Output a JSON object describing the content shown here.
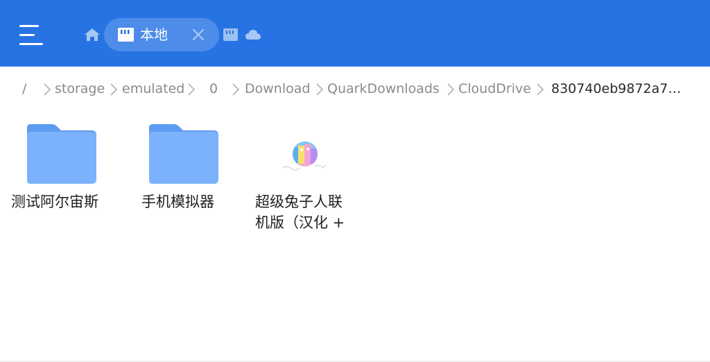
{
  "header": {
    "tabs": [
      {
        "label": "本地",
        "icon": "sd-card-icon",
        "active": true,
        "closable": true
      },
      {
        "label": "",
        "icon": "sd-card-icon",
        "active": false
      },
      {
        "label": "",
        "icon": "cloud-icon",
        "active": false
      }
    ],
    "colors": {
      "bar": "#2773e3",
      "icon": "#ffffff"
    }
  },
  "breadcrumb": {
    "root": "/",
    "items": [
      "storage",
      "emulated",
      "0",
      "Download",
      "QuarkDownloads",
      "CloudDrive"
    ],
    "current": "830740eb9872a7…"
  },
  "files": [
    {
      "name": "测试阿尔宙斯",
      "type": "folder",
      "icon": "folder-icon"
    },
    {
      "name": "手机模拟器",
      "type": "folder",
      "icon": "folder-icon"
    },
    {
      "name_line1": "超级兔子人联",
      "name_line2": "机版（汉化 +",
      "type": "file",
      "icon": "game-thumbnail-icon"
    }
  ],
  "colors": {
    "folder": "#7bb2fb",
    "folder_tab": "#5e9cf3",
    "text": "#1e1e1e",
    "breadcrumb": "#8a8a8a"
  }
}
